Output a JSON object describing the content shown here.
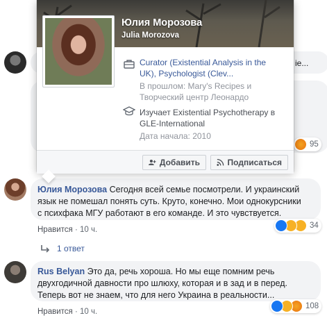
{
  "background_comment": {
    "partial_text": "ie...",
    "reaction_count": "95"
  },
  "hovercard": {
    "name": "Юлия Морозова",
    "alt_name": "Julia Morozova",
    "work_line1": "Curator (Existential Analysis in the",
    "work_line2": "UK), Psychologist (Clev...",
    "past_line1": "В прошлом: Mary's Recipes и",
    "past_line2": "Творческий центр Леонардо",
    "study_line1": "Изучает Existential Psychotherapy в",
    "study_line2": "GLE-International",
    "start_date": "Дата начала: 2010",
    "add_button": "Добавить",
    "follow_button": "Подписаться"
  },
  "comments": [
    {
      "author": "Юлия Морозова",
      "text_line1": "Сегодня всей семье посмотрели. И украинский",
      "text_line2": "язык не помешал понять суть. Круто, конечно. Мои однокурсники",
      "text_line3": "с психфака МГУ работают в его команде. И это чувствуется.",
      "like_label": "Нравится",
      "time": "10 ч.",
      "reaction_count": "34",
      "replies_label": "1 ответ"
    },
    {
      "author": "Rus Belyan",
      "text_line1": "Это да, речь хороша. Но мы еще помним речь",
      "text_line2": "двухгодичной давности про шлюху, которая и в зад и в перед.",
      "text_line3": "Теперь вот не знаем, что для него Украина в реальности...",
      "like_label": "Нравится",
      "time": "10 ч.",
      "reaction_count": "108"
    }
  ],
  "colors": {
    "link": "#385898",
    "bubble": "#f2f3f5",
    "like": "#1877f2",
    "haha": "#f7b125",
    "angry": "#e9710f"
  }
}
